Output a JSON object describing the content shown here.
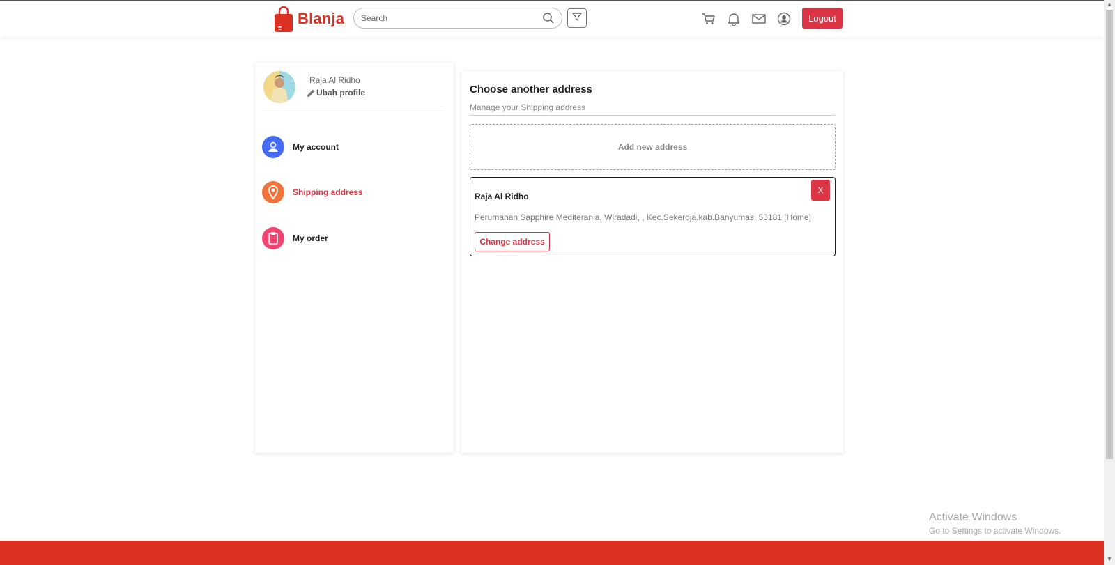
{
  "header": {
    "brand": "Blanja",
    "search": {
      "placeholder": "Search"
    },
    "logout_label": "Logout",
    "icons": [
      "bag-logo-icon",
      "search-icon",
      "filter-icon",
      "cart-icon",
      "bell-icon",
      "mail-icon",
      "user-icon"
    ]
  },
  "sidebar": {
    "profile": {
      "name": "Raja Al Ridho",
      "edit_label": "Ubah profile"
    },
    "items": [
      {
        "label": "My account",
        "icon": "person-icon",
        "color": "#456bf2",
        "active": false
      },
      {
        "label": "Shipping address",
        "icon": "map-pin-icon",
        "color": "#f3733c",
        "active": true
      },
      {
        "label": "My order",
        "icon": "clipboard-icon",
        "color": "#f2446f",
        "active": false
      }
    ]
  },
  "main": {
    "title": "Choose another address",
    "subtitle": "Manage your Shipping address",
    "add_label": "Add new address",
    "address": {
      "name": "Raja Al Ridho",
      "text": "Perumahan Sapphire Mediterania, Wiradadi, , Kec.Sekeroja.kab.Banyumas, 53181 [Home]",
      "delete_label": "X",
      "change_label": "Change address"
    }
  },
  "watermark": {
    "title": "Activate Windows",
    "subtitle": "Go to Settings to activate Windows."
  },
  "colors": {
    "brand": "#db3022",
    "primary": "#db3545"
  }
}
